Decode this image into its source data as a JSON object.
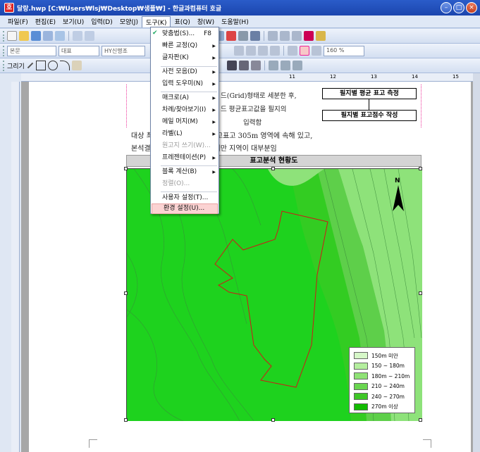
{
  "window": {
    "title": "달랑.hwp [C:₩Users₩lsj₩Desktop₩샘플₩] - 한글과컴퓨터 호글",
    "app_icon": "호"
  },
  "menu": [
    "파일(F)",
    "편집(E)",
    "보기(U)",
    "입력(D)",
    "모양(J)",
    "도구(K)",
    "표(Q)",
    "창(W)",
    "도움말(H)"
  ],
  "toolbar": {
    "style_combo": "본문",
    "font_type_combo": "대표",
    "font_combo": "HY신명조",
    "zoom_combo": "160 %",
    "draw_label": "그리기"
  },
  "ruler_numbers": [
    "11",
    "12",
    "13",
    "14",
    "15"
  ],
  "dropdown": {
    "items": [
      {
        "label": "맞춤법(S)...",
        "shortcut": "F8",
        "arrow": false,
        "disabled": false
      },
      {
        "label": "빠른 교정(Q)",
        "arrow": true,
        "disabled": false
      },
      {
        "label": "글자판(K)",
        "arrow": true,
        "disabled": false
      },
      {
        "label": "사전 모음(D)",
        "arrow": true,
        "disabled": false
      },
      {
        "label": "입력 도우미(N)",
        "arrow": true,
        "disabled": false
      },
      {
        "label": "매크로(A)",
        "arrow": true,
        "disabled": false
      },
      {
        "label": "차례/찾아보기(I)",
        "arrow": true,
        "disabled": false
      },
      {
        "label": "메일 머지(M)",
        "arrow": true,
        "disabled": false
      },
      {
        "label": "라벨(L)",
        "arrow": true,
        "disabled": false
      },
      {
        "label": "원고지 쓰기(W)...",
        "arrow": false,
        "disabled": true
      },
      {
        "label": "프레젠테이션(P)",
        "arrow": true,
        "disabled": false
      },
      {
        "label": "블록 계산(B)",
        "arrow": true,
        "disabled": false
      },
      {
        "label": "정렬(O)...",
        "arrow": false,
        "disabled": true
      },
      {
        "label": "사용자 설정(T)...",
        "arrow": false,
        "disabled": false
      },
      {
        "label": "환경 설정(U)...",
        "arrow": false,
        "disabled": false
      }
    ]
  },
  "document": {
    "text_fragment_1": "드(Grid)형태로 세분한 후,",
    "text_fragment_2": "드 평균표고값을 필지의",
    "text_fragment_3": "입력함",
    "flow_box_1": "필지별 평균 표고 측정",
    "flow_box_2": "필지별 표고점수 작성",
    "para_line_1": "대상              최저표고 266m에서 최고표고 305m 영역에 속해 있고,",
    "para_line_2": "본석결              분포는 240~270m미만 지역이 대부분임",
    "headline": "표고분석 현황도"
  },
  "legend": [
    {
      "label": "150m 미만",
      "color": "#d6f7c8"
    },
    {
      "label": "150 ~ 180m",
      "color": "#b4ee9e"
    },
    {
      "label": "180m ~ 210m",
      "color": "#8fe276"
    },
    {
      "label": "210 ~ 240m",
      "color": "#69d54f"
    },
    {
      "label": "240 ~ 270m",
      "color": "#3ec626"
    },
    {
      "label": "270m 이상",
      "color": "#12bb00"
    }
  ],
  "north_label": "N",
  "colors": {
    "map_green": "#1ed21e",
    "boundary_red": "#d01818"
  }
}
